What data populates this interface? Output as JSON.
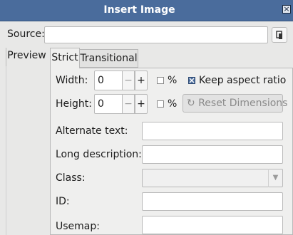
{
  "window": {
    "title": "Insert Image",
    "close_icon": "close-icon"
  },
  "source": {
    "label": "Source:",
    "value": ""
  },
  "tabs": {
    "preview": "Preview",
    "strict": "Strict",
    "transitional": "Transitional"
  },
  "width": {
    "label": "Width:",
    "value": "0",
    "minus": "−",
    "plus": "+",
    "percent": "%",
    "percent_checked": false
  },
  "height": {
    "label": "Height:",
    "value": "0",
    "minus": "−",
    "plus": "+",
    "percent": "%",
    "percent_checked": false
  },
  "keep_aspect": {
    "label": "Keep aspect ratio",
    "checked": true
  },
  "reset_dimensions": {
    "label": "Reset Dimensions",
    "enabled": false
  },
  "fields": {
    "alternate_text": {
      "label": "Alternate text:",
      "value": ""
    },
    "long_description": {
      "label": "Long description:",
      "value": ""
    },
    "class": {
      "label": "Class:",
      "value": ""
    },
    "id": {
      "label": "ID:",
      "value": ""
    },
    "usemap": {
      "label": "Usemap:",
      "value": ""
    }
  },
  "colors": {
    "titlebar": "#4a6c9c",
    "background": "#e8e8e7",
    "checkbox_checked": "#4a6c9c"
  }
}
